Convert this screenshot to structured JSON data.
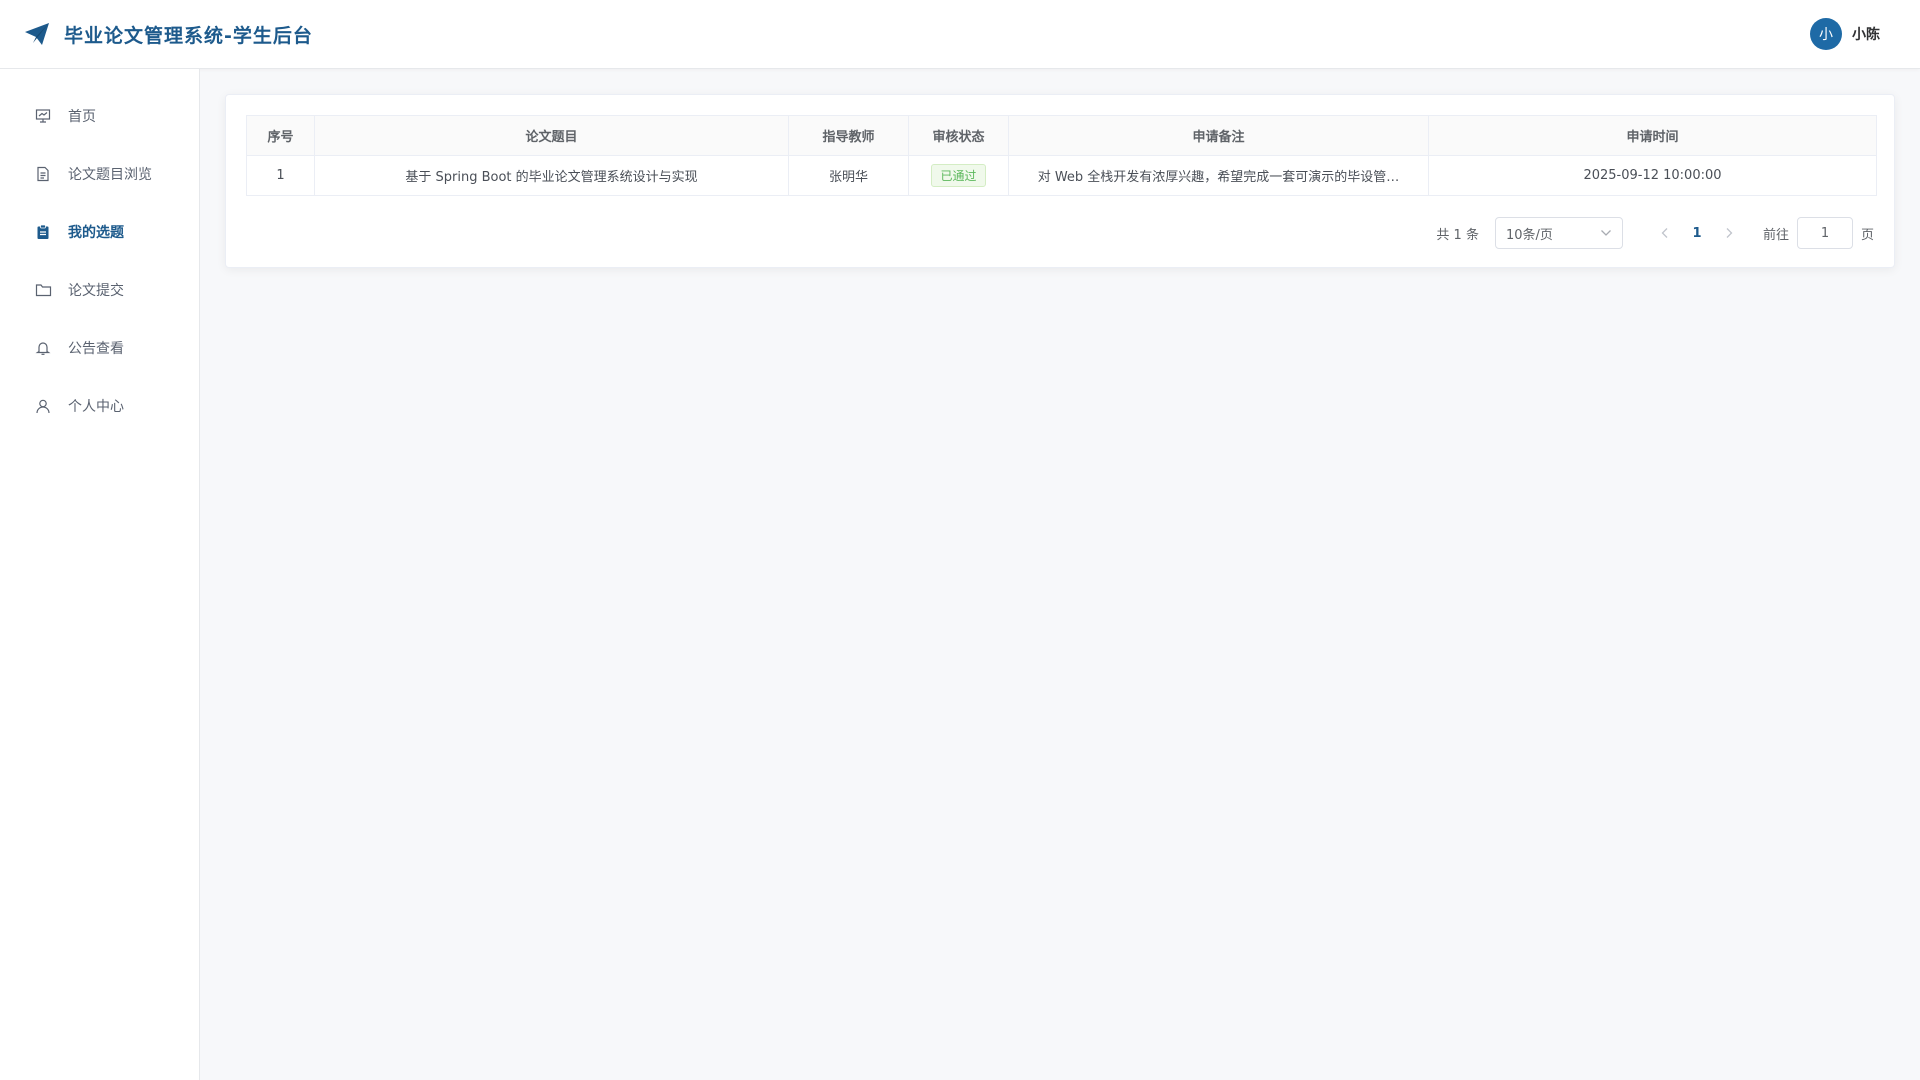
{
  "header": {
    "title": "毕业论文管理系统-学生后台",
    "logo_icon": "paper-plane-icon",
    "avatar_text": "小",
    "username": "小陈"
  },
  "sidebar": {
    "items": [
      {
        "label": "首页",
        "icon": "presentation-icon"
      },
      {
        "label": "论文题目浏览",
        "icon": "document-icon"
      },
      {
        "label": "我的选题",
        "icon": "clipboard-icon",
        "active": true
      },
      {
        "label": "论文提交",
        "icon": "folder-icon"
      },
      {
        "label": "公告查看",
        "icon": "bell-icon"
      },
      {
        "label": "个人中心",
        "icon": "user-icon"
      }
    ]
  },
  "table": {
    "headers": [
      "序号",
      "论文题目",
      "指导教师",
      "审核状态",
      "申请备注",
      "申请时间"
    ],
    "rows": [
      {
        "index": "1",
        "title": "基于 Spring Boot 的毕业论文管理系统设计与实现",
        "teacher": "张明华",
        "status": "已通过",
        "note": "对 Web 全栈开发有浓厚兴趣，希望完成一套可演示的毕设管…",
        "time": "2025-09-12 10:00:00"
      }
    ]
  },
  "pagination": {
    "total": "共 1 条",
    "page_size": "10条/页",
    "current_page": "1",
    "goto_label": "前往",
    "goto_value": "1",
    "page_suffix": "页"
  },
  "colors": {
    "brand": "#1d5a8c",
    "status_ok": "#5cb85c"
  }
}
